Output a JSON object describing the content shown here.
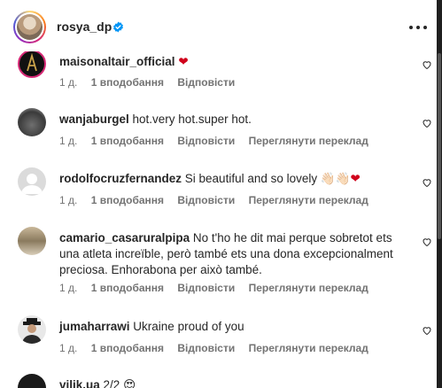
{
  "header": {
    "username": "rosya_dp",
    "verified_icon": "verified-badge-icon",
    "more_icon": "more-options-icon"
  },
  "comments": [
    {
      "username": "maisonaltair_official",
      "text": "",
      "trailing_emoji": "❤",
      "age": "1 д.",
      "likes": "1 вподобання",
      "reply": "Відповісти",
      "translate": ""
    },
    {
      "username": "wanjaburgel",
      "text": "hot.very hot.super hot.",
      "age": "1 д.",
      "likes": "1 вподобання",
      "reply": "Відповісти",
      "translate": "Переглянути переклад"
    },
    {
      "username": "rodolfocruzfernandez",
      "text": "Si beautiful and so lovely 👋🏻👋🏻",
      "trailing_emoji": "❤",
      "age": "1 д.",
      "likes": "1 вподобання",
      "reply": "Відповісти",
      "translate": "Переглянути переклад"
    },
    {
      "username": "camario_casaruralpipa",
      "text": "No t'ho he dit mai perque sobretot ets una atleta increïble, però també ets una dona excepcionalment preciosa. Enhorabona per això també.",
      "age": "1 д.",
      "likes": "1 вподобання",
      "reply": "Відповісти",
      "translate": "Переглянути переклад"
    },
    {
      "username": "jumaharrawi",
      "text": "Ukraine proud of you",
      "age": "1 д.",
      "likes": "1 вподобання",
      "reply": "Відповісти",
      "translate": "Переглянути переклад"
    },
    {
      "username": "vilik.ua",
      "text": "2/2 😍",
      "age": "",
      "likes": "",
      "reply": "",
      "translate": ""
    }
  ],
  "colors": {
    "heart": "#ed1c24",
    "verified": "#0095f6",
    "meta_text": "#737373",
    "text": "#262626"
  }
}
